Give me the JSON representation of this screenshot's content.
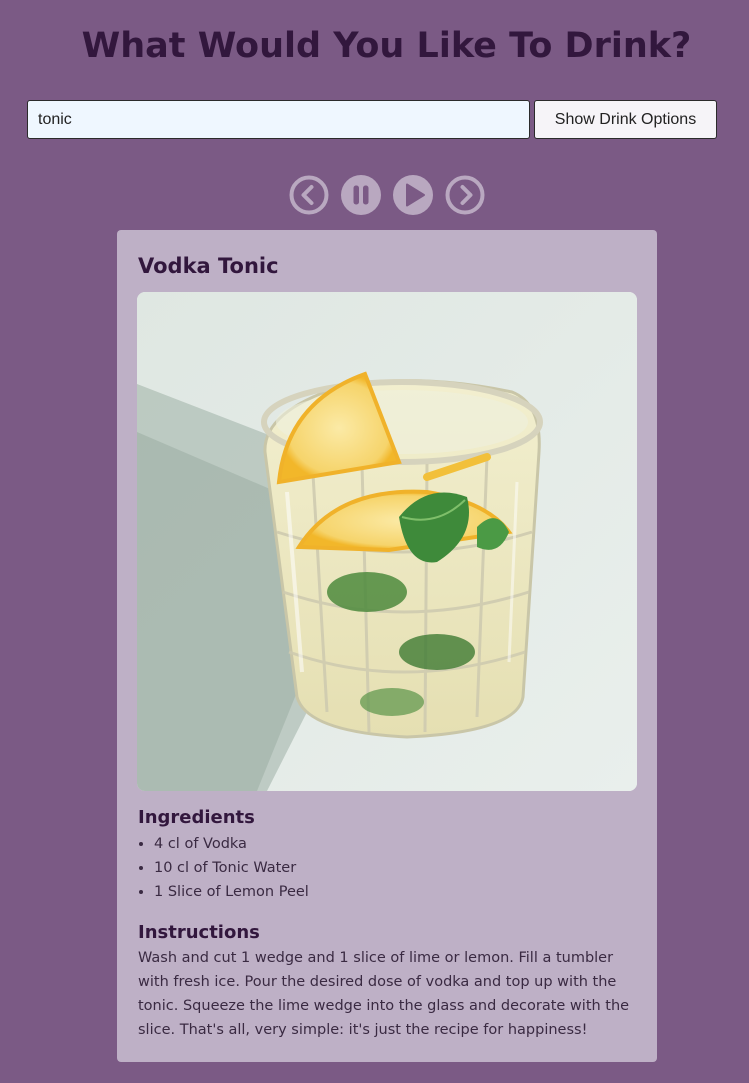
{
  "header": {
    "title": "What Would You Like To Drink?"
  },
  "search": {
    "value": "tonic",
    "button_label": "Show Drink Options"
  },
  "controls": [
    {
      "icon": "chevron-left-circle-icon",
      "action": "previous"
    },
    {
      "icon": "pause-circle-icon",
      "action": "pause"
    },
    {
      "icon": "play-circle-icon",
      "action": "play"
    },
    {
      "icon": "chevron-right-circle-icon",
      "action": "next"
    }
  ],
  "drink": {
    "name": "Vodka Tonic",
    "ingredients_title": "Ingredients",
    "ingredients": [
      "4 cl of Vodka",
      "10 cl of Tonic Water",
      "1 Slice of Lemon Peel"
    ],
    "instructions_title": "Instructions",
    "instructions": "Wash and cut 1 wedge and 1 slice of lime or lemon. Fill a tumbler with fresh ice. Pour the desired dose of vodka and top up with the tonic. Squeeze the lime wedge into the glass and decorate with the slice. That's all, very simple: it's just the recipe for happiness!"
  },
  "colors": {
    "background": "#7b5a85",
    "card": "#beb0c6",
    "title_text": "#32173d",
    "input_background": "#eff7ff",
    "control_icon": "#b9a8c0"
  }
}
